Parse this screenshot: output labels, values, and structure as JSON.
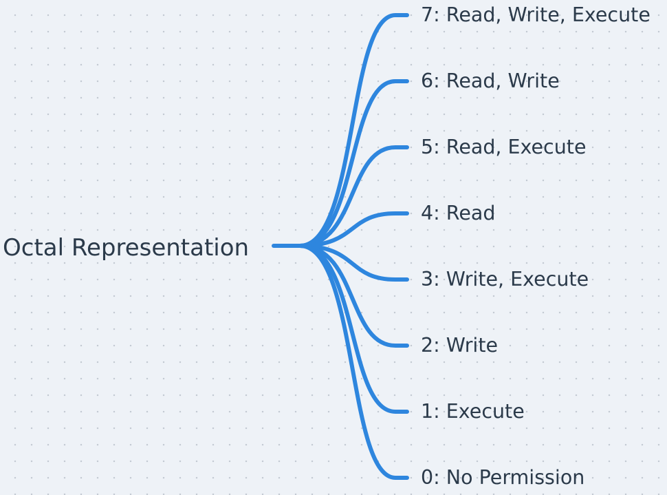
{
  "diagram": {
    "root": {
      "label": "Octal Representation"
    },
    "branches": [
      {
        "label": "7: Read, Write, Execute"
      },
      {
        "label": "6: Read, Write"
      },
      {
        "label": "5: Read, Execute"
      },
      {
        "label": "4: Read"
      },
      {
        "label": "3: Write, Execute"
      },
      {
        "label": "2: Write"
      },
      {
        "label": "1: Execute"
      },
      {
        "label": "0: No Permission"
      }
    ],
    "colors": {
      "connector": "#2e86de",
      "text": "#2b3a4a",
      "background": "#eef2f7"
    }
  }
}
